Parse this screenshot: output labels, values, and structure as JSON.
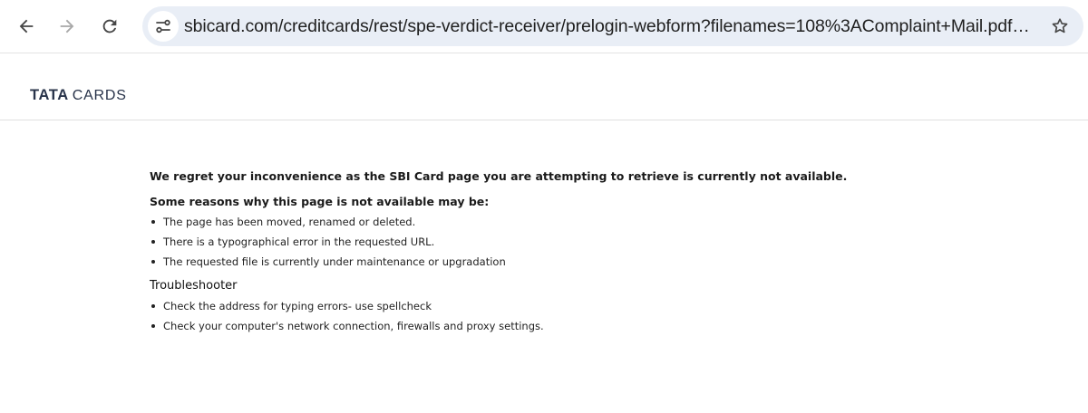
{
  "browser": {
    "url": "sbicard.com/creditcards/rest/spe-verdict-receiver/prelogin-webform?filenames=108%3AComplaint+Mail.pdf%7C10...",
    "back_icon": "arrow-left-icon",
    "forward_icon": "arrow-right-icon",
    "reload_icon": "reload-icon",
    "site_info_icon": "tune-icon",
    "bookmark_icon": "star-outline-icon"
  },
  "header": {
    "logo_bold": "TATA",
    "logo_light": "CARDS"
  },
  "error": {
    "regret_message": "We regret your inconvenience as the SBI Card page you are attempting to retrieve is currently not available.",
    "reasons_title": "Some reasons why this page is not available may be:",
    "reasons": [
      "The page has been moved, renamed or deleted.",
      "There is a typographical error in the requested URL.",
      "The requested file is currently under maintenance or upgradation"
    ],
    "troubleshooter_title": "Troubleshooter",
    "troubleshooter_items": [
      "Check the address for typing errors- use spellcheck",
      "Check your computer's network connection, firewalls and proxy settings."
    ]
  },
  "colors": {
    "omnibox_bg": "#e9eef6",
    "logo_text": "#28334a",
    "icon_color": "#474747"
  }
}
